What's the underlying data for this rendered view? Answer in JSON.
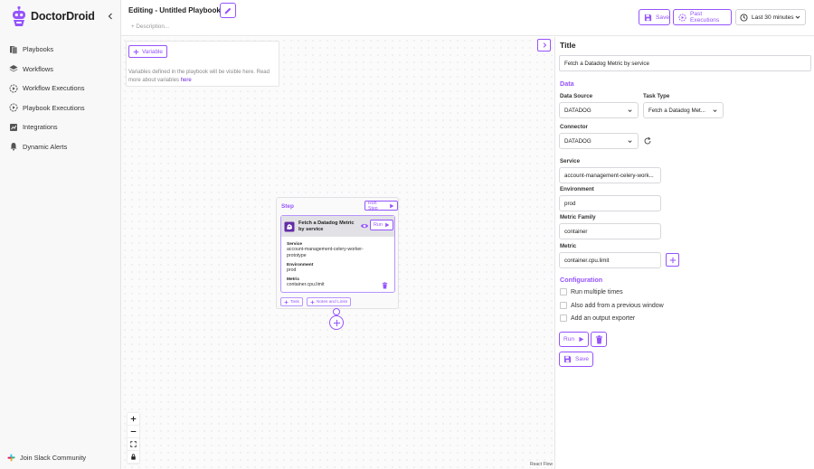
{
  "brand": {
    "name": "DoctorDroid",
    "accent": "#9553fe"
  },
  "sidebar": {
    "items": [
      {
        "label": "Playbooks",
        "icon": "playbooks-icon"
      },
      {
        "label": "Workflows",
        "icon": "layers-icon"
      },
      {
        "label": "Workflow Executions",
        "icon": "workflow-executions-icon"
      },
      {
        "label": "Playbook Executions",
        "icon": "playbook-executions-icon"
      },
      {
        "label": "Integrations",
        "icon": "integrations-icon"
      },
      {
        "label": "Dynamic Alerts",
        "icon": "alert-bell-icon"
      }
    ],
    "slack": "Join Slack Community"
  },
  "header": {
    "title": "Editing - Untitled Playbook",
    "description_placeholder": "+ Description...",
    "save": "Save",
    "past_executions": "Past Executions",
    "time_range": "Last 30 minutes"
  },
  "variables": {
    "button": "Variable",
    "hint": "Variables defined in the playbook will be visible here. Read more about variables",
    "link": "here"
  },
  "step": {
    "label": "Step",
    "run_step": "Run Step",
    "task": {
      "name": "Fetch a Datadog Metric by service",
      "run": "Run",
      "fields": [
        {
          "label": "Service",
          "value": "account-management-celery-worker-prototype"
        },
        {
          "label": "Environment",
          "value": "prod"
        },
        {
          "label": "Metric",
          "value": "container.cpu.limit"
        }
      ]
    },
    "add_task": "Task",
    "notes_links": "Notes and Links"
  },
  "canvas": {
    "attribution": "React Flow"
  },
  "panel": {
    "title_label": "Title",
    "title_value": "Fetch a Datadog Metric by service",
    "data_section": "Data",
    "data_source_label": "Data Source",
    "data_source_value": "DATADOG",
    "task_type_label": "Task Type",
    "task_type_value": "Fetch a Datadog Met...",
    "connector_label": "Connector",
    "connector_value": "DATADOG",
    "service_label": "Service",
    "service_value": "account-management-celery-work...",
    "environment_label": "Environment",
    "environment_value": "prod",
    "metric_family_label": "Metric Family",
    "metric_family_value": "container",
    "metric_label": "Metric",
    "metric_value": "container.cpu.limit",
    "config_section": "Configuration",
    "options": [
      {
        "label": "Run multiple times",
        "checked": false
      },
      {
        "label": "Also add from a previous window",
        "checked": false
      },
      {
        "label": "Add an output exporter",
        "checked": false
      }
    ],
    "run": "Run",
    "save": "Save"
  }
}
